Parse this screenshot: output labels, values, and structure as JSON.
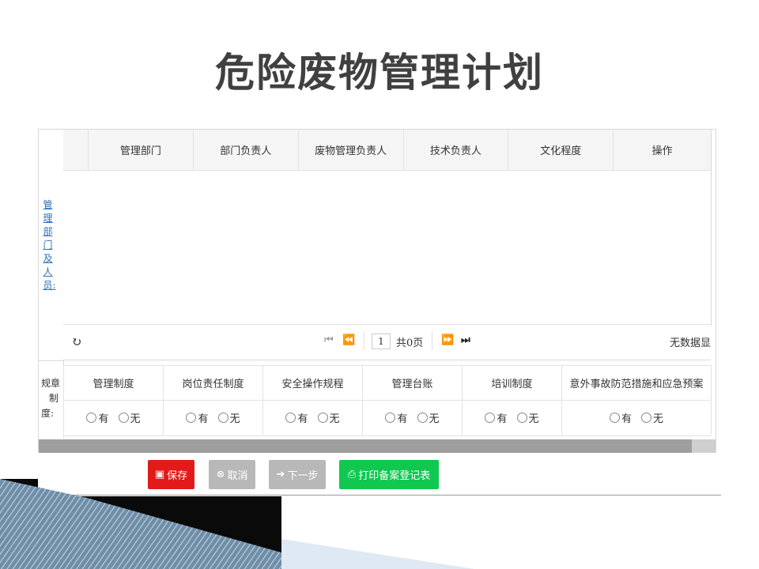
{
  "slide": {
    "title": "危险废物管理计划"
  },
  "dept_section": {
    "label": "管理部门及人员:",
    "columns": [
      "管理部门",
      "部门负责人",
      "废物管理负责人",
      "技术负责人",
      "文化程度",
      "操作"
    ],
    "rows": [],
    "pager": {
      "refresh_icon": "refresh-icon",
      "page_value": "1",
      "total_text": "共0页",
      "empty_text": "无数据显"
    }
  },
  "rules_section": {
    "label_chars": [
      "规章",
      "制",
      "度:"
    ],
    "items": [
      "管理制度",
      "岗位责任制度",
      "安全操作规程",
      "管理台账",
      "培训制度",
      "意外事故防范措施和应急预案"
    ],
    "option_yes": "有",
    "option_no": "无"
  },
  "buttons": {
    "save": "保存",
    "cancel": "取消",
    "next": "下一步",
    "print": "打印备案登记表"
  },
  "colors": {
    "save": "#e21a1a",
    "disabled": "#b8b8b8",
    "print": "#10c84f",
    "link": "#2a6ebd"
  }
}
